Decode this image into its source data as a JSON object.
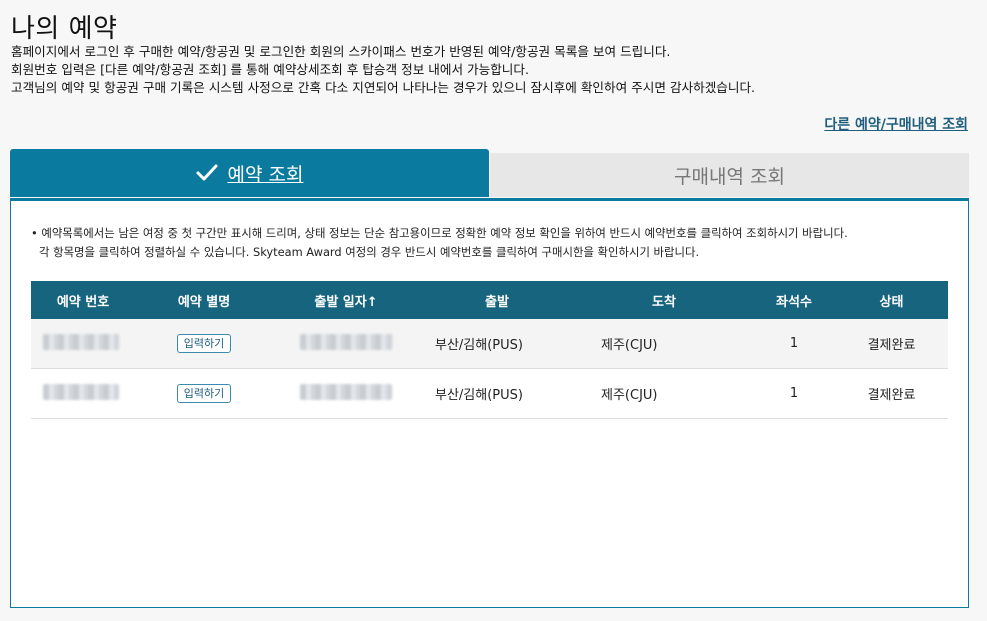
{
  "page": {
    "title": "나의 예약",
    "description": [
      "홈페이지에서 로그인 후 구매한 예약/항공권 및 로그인한 회원의 스카이패스 번호가 반영된 예약/항공권 목록을 보여 드립니다.",
      "회원번호 입력은 [다른 예약/항공권 조회] 를 통해 예약상세조회 후 탑승객 정보 내에서 가능합니다.",
      "고객님의 예약 및 항공권 구매 기록은 시스템 사정으로 간혹 다소 지연되어 나타나는 경우가 있으니 잠시후에 확인하여 주시면 감사하겠습니다."
    ],
    "other_link": "다른 예약/구매내역 조회"
  },
  "tabs": {
    "active": "예약 조회",
    "inactive": "구매내역 조회",
    "active_icon": "check-icon"
  },
  "notice": [
    "• 예약목록에서는 남은 여정 중 첫 구간만 표시해 드리며, 상태 정보는 단순 참고용이므로 정확한 예약 정보 확인을 위하여 반드시 예약번호를 클릭하여 조회하시기 바랍니다.",
    "  각 항목명을 클릭하여 정렬하실 수 있습니다. Skyteam Award 여정의 경우 반드시 예약번호를 클릭하여 구매시한을 확인하시기 바랍니다."
  ],
  "table": {
    "headers": [
      "예약 번호",
      "예약 별명",
      "출발 일자↑",
      "출발",
      "도착",
      "좌석수",
      "상태"
    ],
    "alias_button": "입력하기",
    "rows": [
      {
        "departure": "부산/김해(PUS)",
        "arrival": "제주(CJU)",
        "seats": "1",
        "status": "결제완료"
      },
      {
        "departure": "부산/김해(PUS)",
        "arrival": "제주(CJU)",
        "seats": "1",
        "status": "결제완료"
      }
    ]
  },
  "colors": {
    "accent": "#0b7a9f",
    "table_header": "#17647f",
    "link": "#1f5e7c"
  }
}
